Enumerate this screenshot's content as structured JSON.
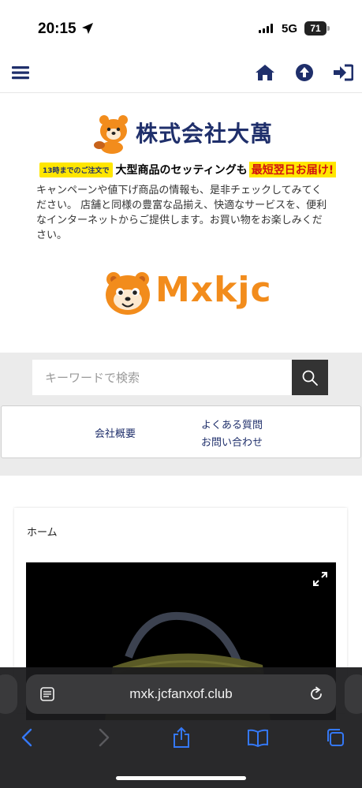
{
  "status_bar": {
    "time": "20:15",
    "network": "5G",
    "battery": "71"
  },
  "header": {
    "company_name": "株式会社大萬",
    "banner_tag": "13時までのご注文で",
    "banner_main": "大型商品のセッティングも",
    "banner_highlight": "最短翌日お届け!",
    "intro": "キャンペーンや値下げ商品の情報も、是非チェックしてみてください。 店舗と同様の豊富な品揃え、快適なサービスを、便利なインターネットからご提供します。お買い物をお楽しみください。",
    "brand": "Mxkjc"
  },
  "search": {
    "placeholder": "キーワードで検索"
  },
  "menu": {
    "company_overview": "会社概要",
    "faq": "よくある質問",
    "contact": "お問い合わせ"
  },
  "content": {
    "breadcrumb": "ホーム"
  },
  "browser": {
    "url": "mxk.jcfanxof.club"
  },
  "colors": {
    "navy": "#1f2f6b",
    "orange": "#f28c1c",
    "ios_blue": "#3478f6"
  },
  "icons": [
    "menu-icon",
    "home-icon",
    "arrow-up-circle-icon",
    "sign-in-icon",
    "search-icon",
    "expand-icon",
    "reader-icon",
    "reload-icon",
    "back-icon",
    "forward-icon",
    "share-icon",
    "bookmarks-icon",
    "tabs-icon"
  ]
}
